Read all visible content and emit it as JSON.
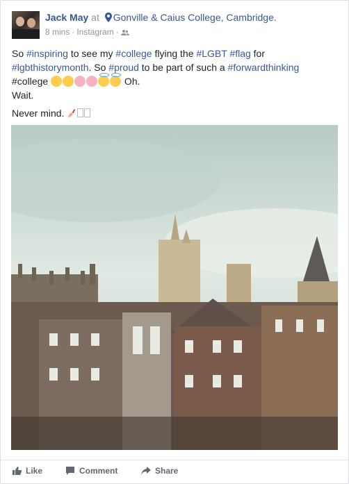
{
  "post": {
    "author": "Jack May",
    "at_word": "at",
    "location": "Gonville & Caius College, Cambridge.",
    "time": "8 mins",
    "source": "Instagram",
    "text": {
      "l1": [
        "So ",
        "#inspiring",
        " to see my ",
        "#college",
        " flying the ",
        "#LGBT",
        " ",
        "#flag",
        " for"
      ],
      "l2": [
        "#lgbthistorymonth",
        ". So ",
        "#proud",
        " to be part of such a ",
        "#forwardthinking"
      ],
      "l3_start": "#college ",
      "l3_end": " Oh.",
      "wait": "Wait.",
      "never": "Never mind."
    },
    "emoji_names": [
      "smiling-face",
      "smiling-face",
      "heart-eyes-face",
      "heart-eyes-face",
      "halo-face",
      "halo-face"
    ]
  },
  "actions": {
    "like": "Like",
    "comment": "Comment",
    "share": "Share"
  },
  "colors": {
    "link": "#365899",
    "meta": "#90949c",
    "action": "#606770"
  }
}
